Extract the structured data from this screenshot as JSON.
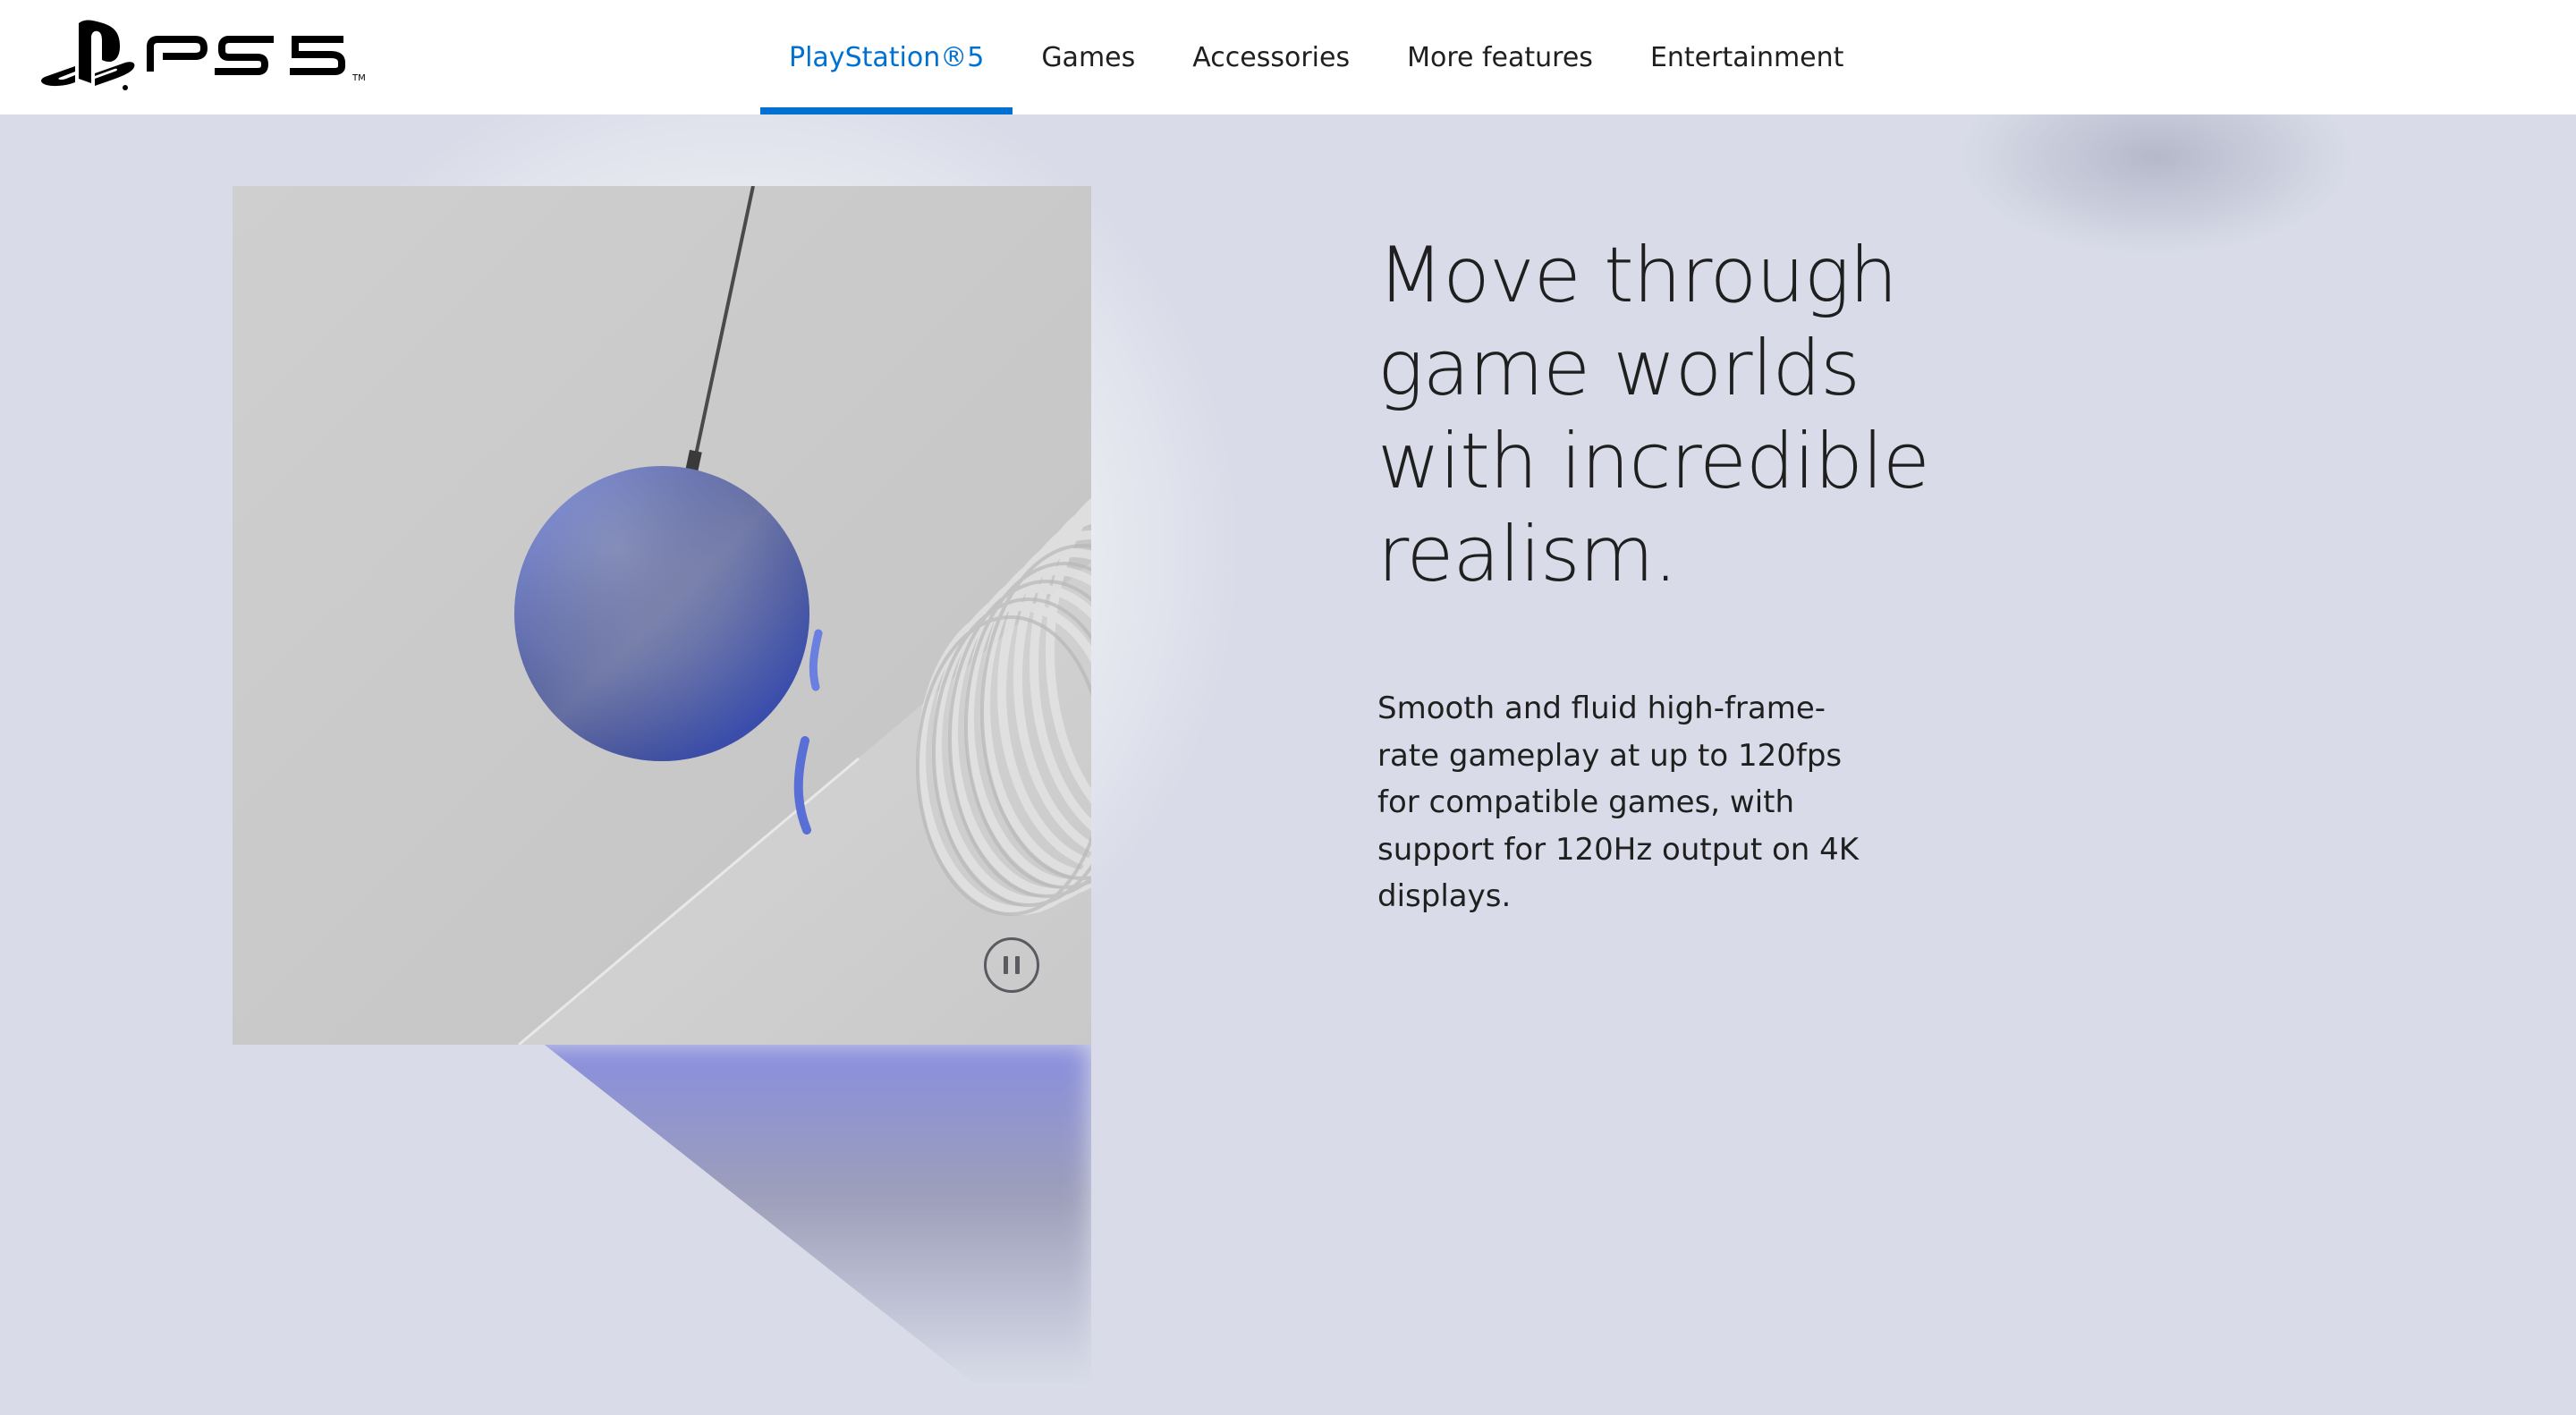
{
  "header": {
    "logo_alt": "PS5",
    "nav": [
      {
        "label": "PlayStation®5",
        "active": true
      },
      {
        "label": "Games",
        "active": false
      },
      {
        "label": "Accessories",
        "active": false
      },
      {
        "label": "More features",
        "active": false
      },
      {
        "label": "Entertainment",
        "active": false
      }
    ]
  },
  "main": {
    "headline": "Move through game worlds with incredible realism.",
    "body": "Smooth and fluid high-frame-rate gameplay at up to 120fps for compatible games, with support for 120Hz output on 4K displays.",
    "media": {
      "pause_icon": "pause-icon"
    }
  },
  "colors": {
    "accent": "#0070d1",
    "background": "#d9dce8",
    "header": "#ffffff",
    "text": "#1f1f1f"
  }
}
